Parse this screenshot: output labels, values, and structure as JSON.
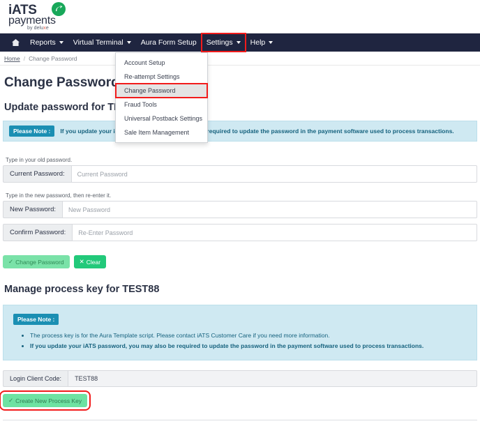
{
  "brand": {
    "name_top": "iATS",
    "name_bottom": "payments",
    "tagline_pre": "by delu",
    "tagline_x": "x",
    "tagline_post": "e",
    "accent_green": "#18a85a",
    "navy": "#2b3245"
  },
  "nav": {
    "home_icon": "home-icon",
    "items": [
      {
        "label": "Reports",
        "has_caret": true,
        "highlighted": false
      },
      {
        "label": "Virtual Terminal",
        "has_caret": true,
        "highlighted": false
      },
      {
        "label": "Aura Form Setup",
        "has_caret": false,
        "highlighted": false
      },
      {
        "label": "Settings",
        "has_caret": true,
        "highlighted": true
      },
      {
        "label": "Help",
        "has_caret": true,
        "highlighted": false
      }
    ],
    "bar_color": "#1f2540",
    "highlight_color": "#f21b1b"
  },
  "dropdown": {
    "open_for": "Settings",
    "items": [
      {
        "label": "Account Setup",
        "active": false,
        "highlighted": false
      },
      {
        "label": "Re-attempt Settings",
        "active": false,
        "highlighted": false
      },
      {
        "label": "Change Password",
        "active": true,
        "highlighted": true
      },
      {
        "label": "Fraud Tools",
        "active": false,
        "highlighted": false
      },
      {
        "label": "Universal Postback Settings",
        "active": false,
        "highlighted": false
      },
      {
        "label": "Sale Item Management",
        "active": false,
        "highlighted": false
      }
    ]
  },
  "breadcrumb": {
    "home": "Home",
    "separator": "/",
    "current": "Change Password"
  },
  "page": {
    "title": "Change Password"
  },
  "update_section": {
    "heading": "Update password for TEST88",
    "note_badge": "Please Note :",
    "note_text": "If you update your iATS password, you may also be required to update the password in the payment software used to process transactions."
  },
  "form": {
    "hint_old": "Type in your old password.",
    "hint_new": "Type in the new password, then re-enter it.",
    "required_marker": "*",
    "fields": [
      {
        "label": "Current Password:",
        "placeholder": "Current Password",
        "value": "",
        "required": true
      },
      {
        "label": "New Password:",
        "placeholder": "New Password",
        "value": "",
        "required": true
      },
      {
        "label": "Confirm Password:",
        "placeholder": "Re-Enter Password",
        "value": "",
        "required": true
      }
    ],
    "submit_label": "Change Password",
    "submit_icon": "check-icon",
    "clear_label": "Clear",
    "clear_icon": "x-icon"
  },
  "process_key_section": {
    "heading": "Manage process key for TEST88",
    "note_badge": "Please Note :",
    "bullets": [
      {
        "text": "The process key is for the Aura Template script. Please contact iATS Customer Care if you need more information.",
        "bold": false
      },
      {
        "text": "If you update your iATS password, you may also be required to update the password in the payment software used to process transactions.",
        "bold": true
      }
    ],
    "client_code_label": "Login Client Code:",
    "client_code_value": "TEST88",
    "create_key_label": "Create New Process Key",
    "create_key_icon": "check-icon"
  },
  "colors": {
    "note_bg": "#cfe9f2",
    "note_badge_bg": "#1b8fb3",
    "note_text": "#16627e",
    "btn_green": "#22c97a",
    "btn_mint": "#6ee2a2",
    "required_red": "#e8291f"
  }
}
